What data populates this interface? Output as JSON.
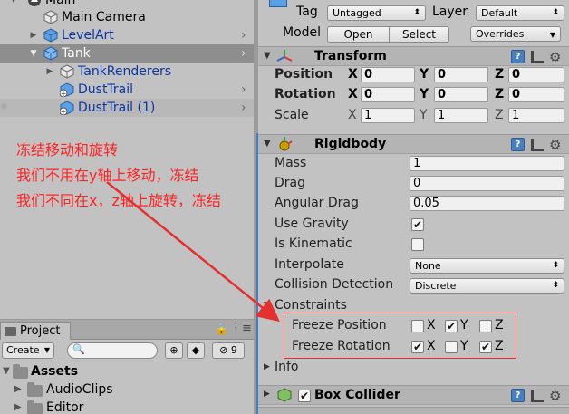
{
  "hierarchy": {
    "scene": "Main",
    "items": [
      {
        "label": "Main Camera"
      },
      {
        "label": "LevelArt"
      },
      {
        "label": "Tank"
      },
      {
        "label": "TankRenderers"
      },
      {
        "label": "DustTrail"
      },
      {
        "label": "DustTrail (1)"
      }
    ]
  },
  "project": {
    "tab_label": "Project",
    "create_label": "Create",
    "badge_count": "9",
    "assets_label": "Assets",
    "folders": [
      "AudioClips",
      "Editor"
    ]
  },
  "inspector": {
    "tag_label": "Tag",
    "tag_value": "Untagged",
    "layer_label": "Layer",
    "layer_value": "Default",
    "model_label": "Model",
    "open_label": "Open",
    "select_label": "Select",
    "overrides_label": "Overrides",
    "transform": {
      "title": "Transform",
      "position_label": "Position",
      "rotation_label": "Rotation",
      "scale_label": "Scale",
      "axis_x": "X",
      "axis_y": "Y",
      "axis_z": "Z",
      "position": [
        "0",
        "0",
        "0"
      ],
      "rotation": [
        "0",
        "0",
        "0"
      ],
      "scale": [
        "1",
        "1",
        "1"
      ]
    },
    "rigidbody": {
      "title": "Rigidbody",
      "mass_label": "Mass",
      "mass": "1",
      "drag_label": "Drag",
      "drag": "0",
      "angular_drag_label": "Angular Drag",
      "angular_drag": "0.05",
      "use_gravity_label": "Use Gravity",
      "use_gravity": true,
      "is_kinematic_label": "Is Kinematic",
      "is_kinematic": false,
      "interpolate_label": "Interpolate",
      "interpolate": "None",
      "collision_label": "Collision Detection",
      "collision": "Discrete",
      "constraints_label": "Constraints",
      "freeze_position_label": "Freeze Position",
      "freeze_rotation_label": "Freeze Rotation",
      "freeze_position": {
        "x": false,
        "y": true,
        "z": false
      },
      "freeze_rotation": {
        "x": true,
        "y": false,
        "z": true
      },
      "info_label": "Info"
    },
    "box_collider": {
      "title": "Box Collider"
    }
  },
  "annotations": {
    "line1": "冻结移动和旋转",
    "line2": "我们不用在y轴上移动，冻结",
    "line3": "我们不同在x，z轴上旋转，冻结",
    "color": "#ff2222"
  },
  "colors": {
    "selection": "#8e8e8e",
    "panel": "#c2c2c2",
    "prefab_blue": "#0b36a8",
    "accent": "#3c7fd0"
  }
}
